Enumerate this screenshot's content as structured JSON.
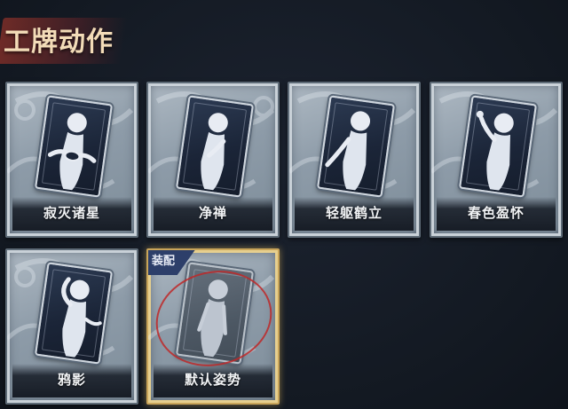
{
  "section_title": "工牌动作",
  "cards": [
    {
      "label": "寂灭诸星",
      "equipped": false,
      "pose": "pose-hands-front-icon"
    },
    {
      "label": "净禅",
      "equipped": false,
      "pose": "pose-hand-chest-icon"
    },
    {
      "label": "轻躯鹤立",
      "equipped": false,
      "pose": "pose-arm-down-icon"
    },
    {
      "label": "春色盈怀",
      "equipped": false,
      "pose": "pose-arm-raised-flower-icon"
    },
    {
      "label": "鸦影",
      "equipped": false,
      "pose": "pose-hand-head-icon"
    },
    {
      "label": "默认姿势",
      "equipped": true,
      "badge": "装配",
      "pose": "pose-default-icon"
    }
  ],
  "colors": {
    "background": "#151b25",
    "title_text": "#f3dcb8",
    "equipped_border": "#c9a55a",
    "equipped_badge": "#2d3f6a",
    "highlight_ring": "#be2828"
  }
}
